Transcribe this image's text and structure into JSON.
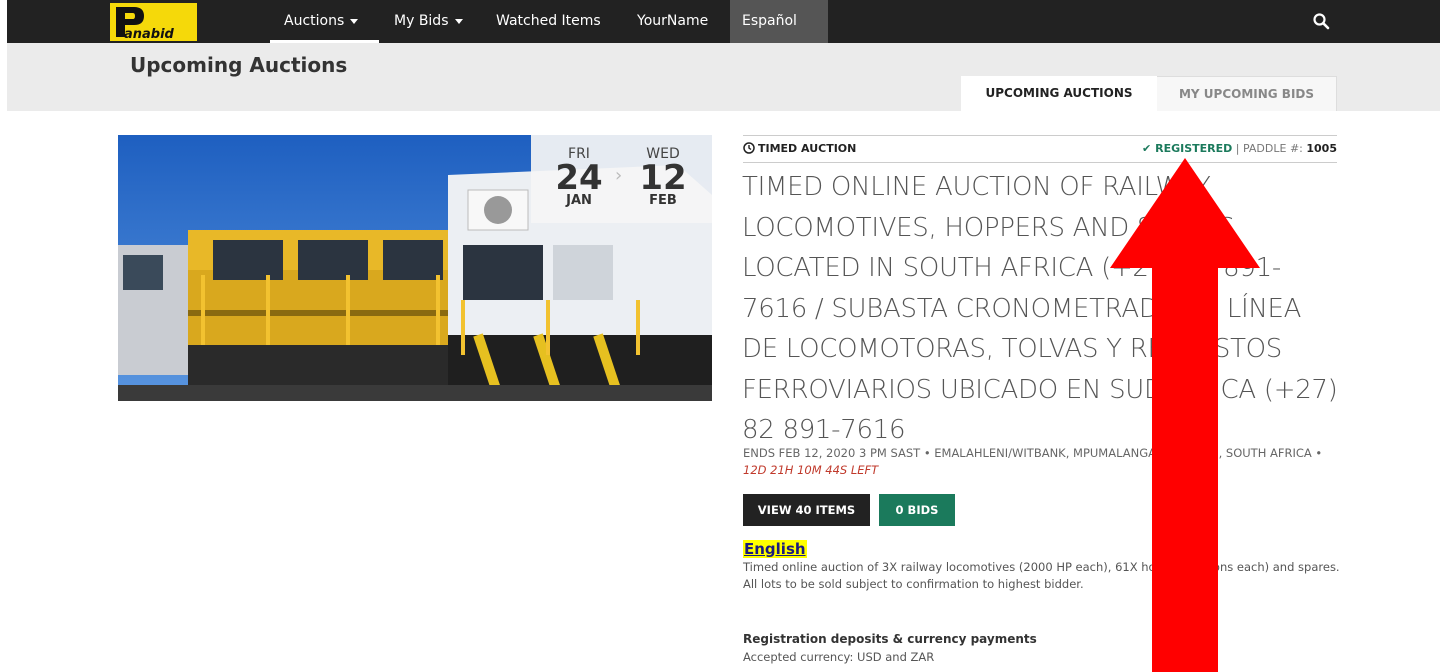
{
  "navbar": {
    "logo_text": "Panabid",
    "items": [
      {
        "label": "Auctions",
        "has_caret": true
      },
      {
        "label": "My Bids",
        "has_caret": true
      },
      {
        "label": "Watched Items",
        "has_caret": false
      },
      {
        "label": "YourName",
        "has_caret": false
      }
    ],
    "language": "Español",
    "search_icon": "search-icon"
  },
  "header": {
    "page_title": "Upcoming Auctions",
    "tabs": [
      {
        "label": "UPCOMING AUCTIONS",
        "active": true
      },
      {
        "label": "MY UPCOMING BIDS",
        "active": false
      }
    ]
  },
  "auction": {
    "start": {
      "dow": "FRI",
      "day": "24",
      "month": "JAN"
    },
    "end": {
      "dow": "WED",
      "day": "12",
      "month": "FEB"
    },
    "type": "TIMED AUCTION",
    "registration_status": "REGISTERED",
    "paddle_label": "PADDLE #:",
    "paddle_number": "1005",
    "title": "TIMED ONLINE AUCTION OF RAILWAY LOCOMOTIVES, HOPPERS AND SPARES LOCATED IN SOUTH AFRICA (+27) 82 891-7616 / SUBASTA CRONOMETRADA EN LÍNEA DE LOCOMOTORAS, TOLVAS Y REPUESTOS FERROVIARIOS UBICADO EN SUDÁFRICA (+27) 82 891-7616",
    "meta": "ENDS FEB 12, 2020 3 PM SAST • EMALAHLENI/WITBANK, MPUMALANGA PROVINCE, SOUTH AFRICA •",
    "time_left": "12D 21H 10M 44S LEFT",
    "view_button": "VIEW 40 ITEMS",
    "bids_button": "0 BIDS",
    "language_heading": "English",
    "description_1": "Timed online auction of 3X railway locomotives (2000 HP each), 61X hopper (50 tons each) and spares.",
    "description_2": "All lots to be sold subject to confirmation to highest bidder.",
    "deposits_heading": "Registration deposits & currency payments",
    "currency_line": "Accepted currency: USD and ZAR"
  },
  "colors": {
    "navbar_bg": "#222222",
    "accent_green": "#1b7a5c",
    "header_band": "#ebebeb",
    "arrow_red": "#ff0000",
    "highlight_yellow": "#ffff00"
  }
}
